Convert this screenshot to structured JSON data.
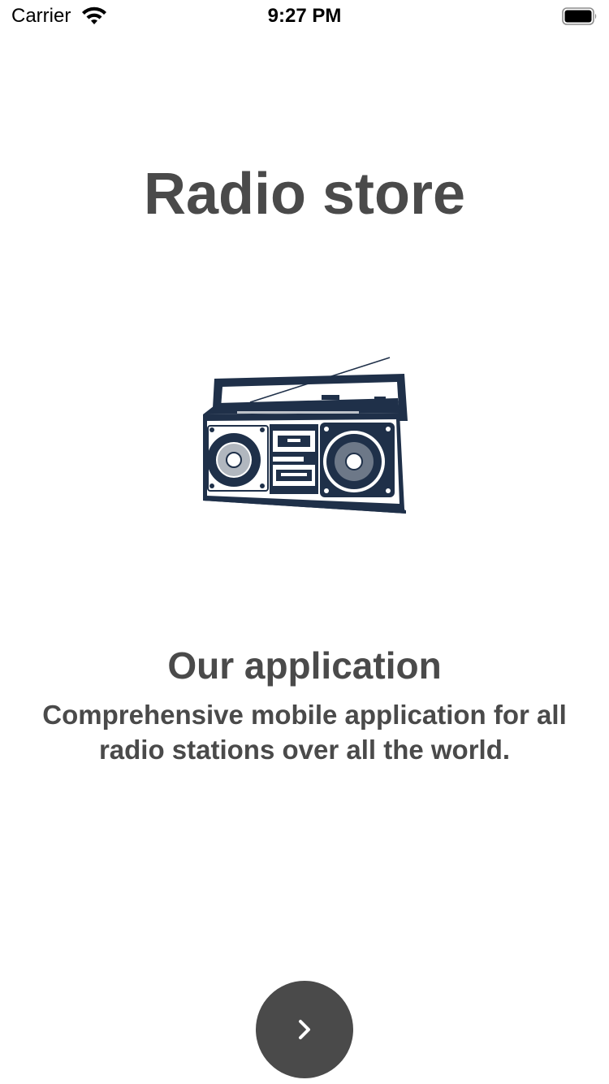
{
  "status_bar": {
    "carrier": "Carrier",
    "time": "9:27 PM",
    "wifi_icon": "wifi-icon",
    "battery_icon": "battery-full-icon"
  },
  "onboarding": {
    "title": "Radio store",
    "illustration": "boombox-illustration",
    "heading": "Our application",
    "description": "Comprehensive mobile application for all radio stations over all the world.",
    "next_icon": "chevron-right-icon"
  },
  "colors": {
    "text": "#4a4a4a",
    "button": "#4a4a4a",
    "illustration": "#1f3049",
    "background": "#ffffff"
  }
}
